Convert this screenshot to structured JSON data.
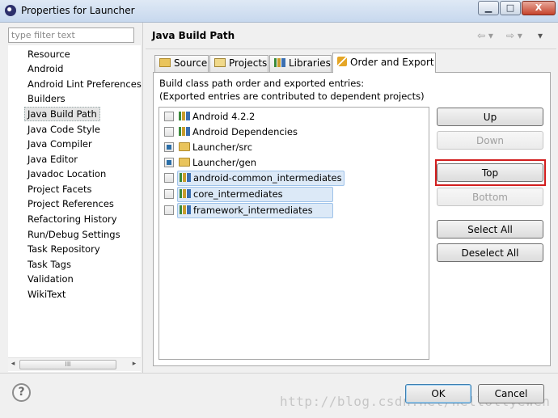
{
  "window": {
    "title": "Properties for Launcher",
    "icon": "eclipse-icon",
    "controls": {
      "minimize": "▁",
      "maximize": "□",
      "close": "X"
    }
  },
  "sidebar": {
    "filter_placeholder": "type filter text",
    "items": [
      {
        "label": "Resource"
      },
      {
        "label": "Android"
      },
      {
        "label": "Android Lint Preferences"
      },
      {
        "label": "Builders"
      },
      {
        "label": "Java Build Path",
        "selected": true
      },
      {
        "label": "Java Code Style"
      },
      {
        "label": "Java Compiler"
      },
      {
        "label": "Java Editor"
      },
      {
        "label": "Javadoc Location"
      },
      {
        "label": "Project Facets"
      },
      {
        "label": "Project References"
      },
      {
        "label": "Refactoring History"
      },
      {
        "label": "Run/Debug Settings"
      },
      {
        "label": "Task Repository"
      },
      {
        "label": "Task Tags"
      },
      {
        "label": "Validation"
      },
      {
        "label": "WikiText"
      }
    ],
    "scroll": {
      "left": "◂",
      "right": "▸",
      "grip": "III"
    }
  },
  "page": {
    "title": "Java Build Path",
    "nav": {
      "back": "⇦ ▾",
      "forward": "⇨ ▾",
      "menu": "▾"
    }
  },
  "tabs": [
    {
      "label": "Source",
      "icon": "source-folder-icon"
    },
    {
      "label": "Projects",
      "icon": "projects-icon"
    },
    {
      "label": "Libraries",
      "icon": "libraries-icon"
    },
    {
      "label": "Order and Export",
      "icon": "order-export-icon",
      "active": true
    }
  ],
  "order_export": {
    "description_line1": "Build class path order and exported entries:",
    "description_line2": "(Exported entries are contributed to dependent projects)",
    "entries": [
      {
        "label": "Android 4.2.2",
        "checked": false,
        "icon": "library-icon",
        "selected": false
      },
      {
        "label": "Android Dependencies",
        "checked": false,
        "icon": "library-icon",
        "selected": false
      },
      {
        "label": "Launcher/src",
        "checked": true,
        "icon": "source-folder-icon",
        "selected": false
      },
      {
        "label": "Launcher/gen",
        "checked": true,
        "icon": "source-folder-icon",
        "selected": false
      },
      {
        "label": "android-common_intermediates",
        "checked": false,
        "icon": "library-icon",
        "selected": true
      },
      {
        "label": "core_intermediates",
        "checked": false,
        "icon": "library-icon",
        "selected": true
      },
      {
        "label": "framework_intermediates",
        "checked": false,
        "icon": "library-icon",
        "selected": true
      }
    ],
    "buttons": {
      "up": "Up",
      "down": "Down",
      "top": "Top",
      "bottom": "Bottom",
      "select_all": "Select All",
      "deselect_all": "Deselect All"
    },
    "highlight_color": "#d21e1e"
  },
  "footer": {
    "help": "?",
    "ok": "OK",
    "cancel": "Cancel",
    "watermark": "http://blog.csdn.net/hellollyewen"
  }
}
